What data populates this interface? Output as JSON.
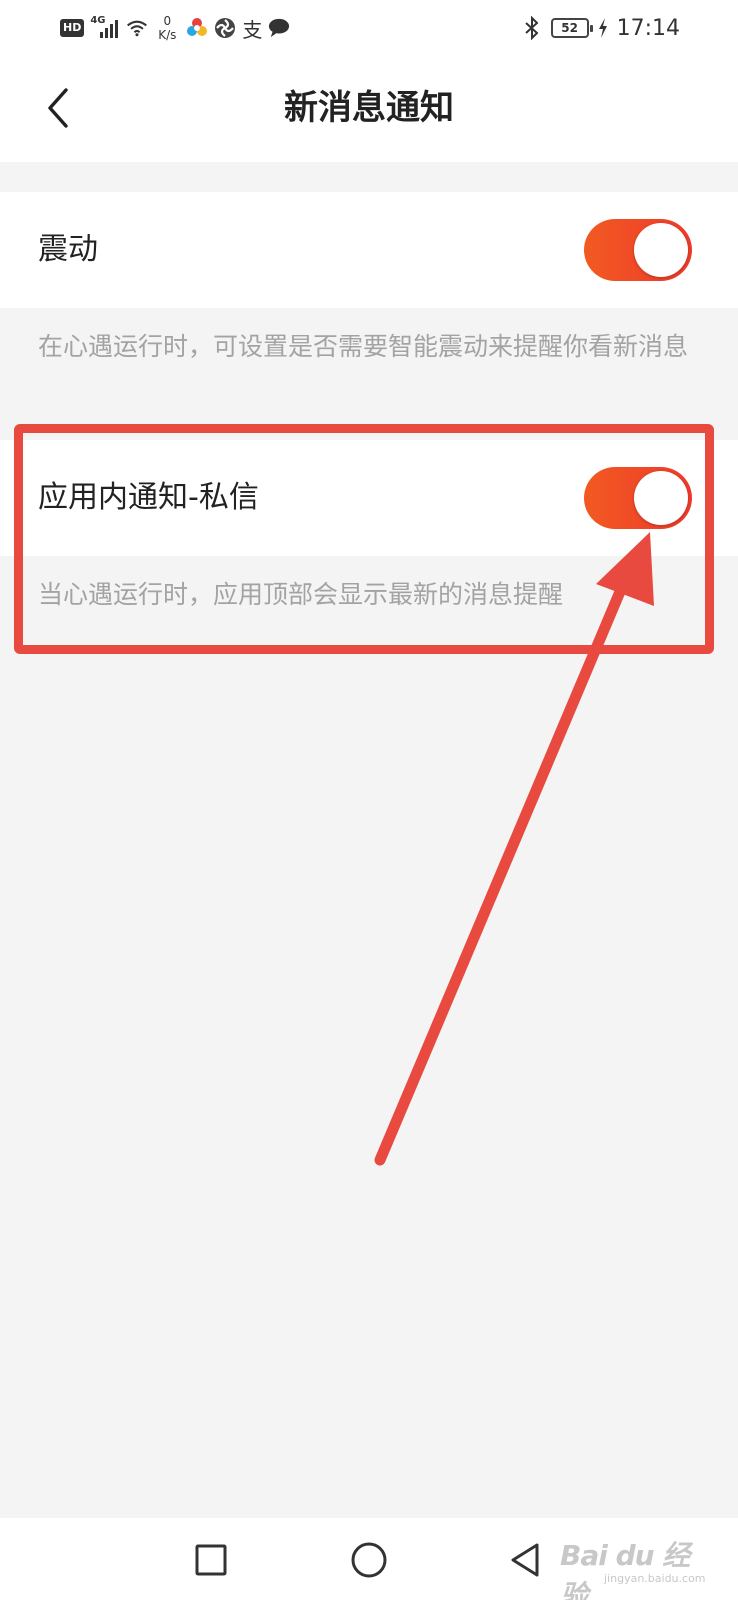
{
  "status_bar": {
    "hd": "HD",
    "network": "4G",
    "speed_value": "0",
    "speed_unit": "K/s",
    "pay_char": "支",
    "battery": "52",
    "time": "17:14",
    "icons": [
      "signal-icon",
      "wifi-icon",
      "app-color-icon",
      "app-swirl-icon",
      "alipay-icon",
      "chat-bubble-icon",
      "bluetooth-icon",
      "battery-icon",
      "charging-icon"
    ]
  },
  "header": {
    "title": "新消息通知",
    "back_icon": "chevron-left-icon"
  },
  "settings": [
    {
      "label": "震动",
      "enabled": true,
      "description": "在心遇运行时，可设置是否需要智能震动来提醒你看新消息"
    },
    {
      "label": "应用内通知-私信",
      "enabled": true,
      "description": "当心遇运行时，应用顶部会显示最新的消息提醒"
    }
  ],
  "nav_bar": {
    "icons": [
      "square-recent-icon",
      "circle-home-icon",
      "triangle-back-icon"
    ]
  },
  "watermark": {
    "brand": "Bai du 经验",
    "url": "jingyan.baidu.com"
  },
  "colors": {
    "accent": "#f04a25",
    "annotation": "#e84a3f",
    "background": "#f4f4f5",
    "desc_text": "#a3a3a3"
  }
}
